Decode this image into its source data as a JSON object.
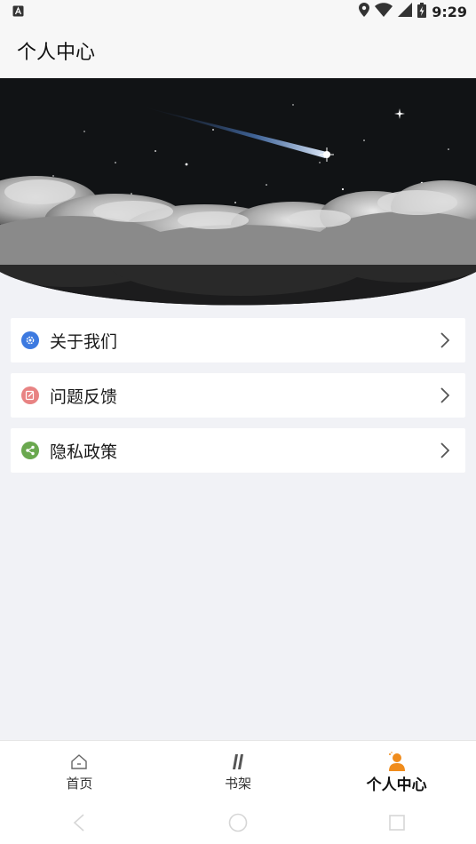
{
  "status_bar": {
    "time": "9:29",
    "left_icon": "a-notification-icon",
    "icons": [
      "location-icon",
      "wifi-icon",
      "signal-icon",
      "battery-charging-icon"
    ]
  },
  "header": {
    "title": "个人中心"
  },
  "menu": {
    "items": [
      {
        "label": "关于我们",
        "icon": "settings-gear-icon",
        "icon_color": "#3d7ae0"
      },
      {
        "label": "问题反馈",
        "icon": "edit-note-icon",
        "icon_color": "#e88383"
      },
      {
        "label": "隐私政策",
        "icon": "share-icon",
        "icon_color": "#6aa84f"
      }
    ]
  },
  "bottom_nav": {
    "tabs": [
      {
        "label": "首页",
        "icon": "home-icon",
        "active": false
      },
      {
        "label": "书架",
        "icon": "bookshelf-icon",
        "active": false
      },
      {
        "label": "个人中心",
        "icon": "person-icon",
        "active": true
      }
    ],
    "active_color": "#f08c1c"
  },
  "colors": {
    "background": "#f1f2f6",
    "card": "#ffffff",
    "banner_sky": "#111315"
  }
}
